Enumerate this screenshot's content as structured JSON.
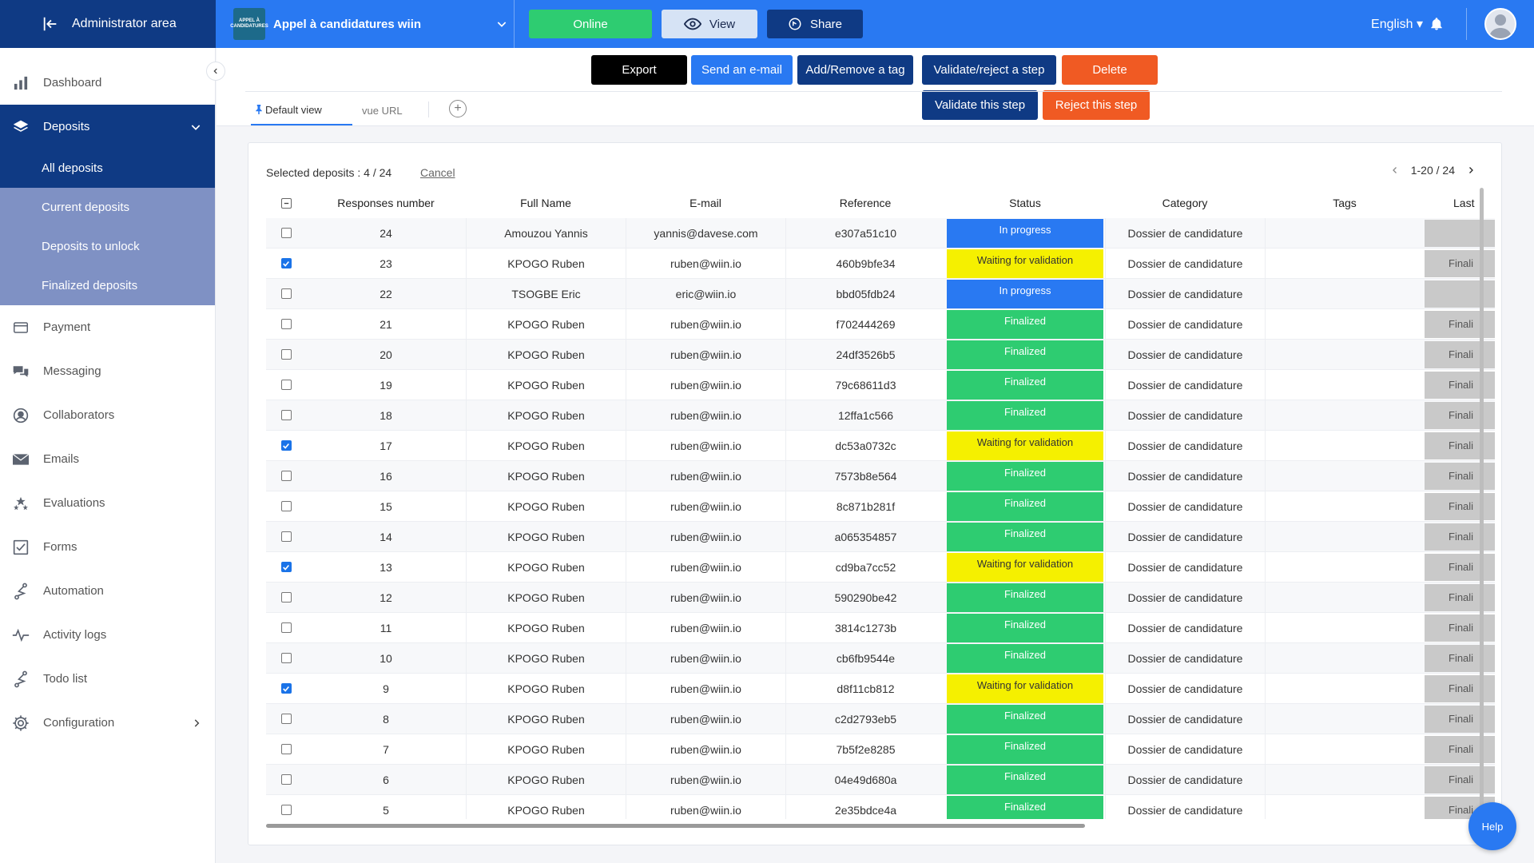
{
  "topbar": {
    "admin_label": "Administrator area",
    "project_name": "Appel à candidatures wiin",
    "project_logo_text": "APPEL À CANDIDATURES",
    "online_label": "Online",
    "view_label": "View",
    "share_label": "Share",
    "language": "English"
  },
  "sidebar": {
    "dashboard": "Dashboard",
    "deposits": "Deposits",
    "sub": {
      "all": "All deposits",
      "current": "Current deposits",
      "unlock": "Deposits to unlock",
      "finalized": "Finalized deposits"
    },
    "payment": "Payment",
    "messaging": "Messaging",
    "collaborators": "Collaborators",
    "emails": "Emails",
    "evaluations": "Evaluations",
    "forms": "Forms",
    "automation": "Automation",
    "activity_logs": "Activity logs",
    "todo": "Todo list",
    "configuration": "Configuration"
  },
  "actions": {
    "export": "Export",
    "send_email": "Send an e-mail",
    "tag": "Add/Remove a tag",
    "validate_reject": "Validate/reject a step",
    "delete": "Delete",
    "validate_step": "Validate this step",
    "reject_step": "Reject this step"
  },
  "tabs": {
    "default": "Default view",
    "url": "vue URL"
  },
  "table": {
    "selected_info": "Selected deposits : 4 / 24",
    "cancel": "Cancel",
    "pagination": "1-20 / 24",
    "headers": {
      "responses": "Responses number",
      "name": "Full Name",
      "email": "E-mail",
      "reference": "Reference",
      "status": "Status",
      "category": "Category",
      "tags": "Tags",
      "last": "Last"
    },
    "rows": [
      {
        "num": "24",
        "name": "Amouzou Yannis",
        "email": "yannis@davese.com",
        "ref": "e307a51c10",
        "status": "In progress",
        "category": "Dossier de candidature",
        "last": ""
      },
      {
        "num": "23",
        "name": "KPOGO Ruben",
        "email": "ruben@wiin.io",
        "ref": "460b9bfe34",
        "status": "Waiting for validation",
        "category": "Dossier de candidature",
        "last": "Finali"
      },
      {
        "num": "22",
        "name": "TSOGBE Eric",
        "email": "eric@wiin.io",
        "ref": "bbd05fdb24",
        "status": "In progress",
        "category": "Dossier de candidature",
        "last": ""
      },
      {
        "num": "21",
        "name": "KPOGO Ruben",
        "email": "ruben@wiin.io",
        "ref": "f702444269",
        "status": "Finalized",
        "category": "Dossier de candidature",
        "last": "Finali"
      },
      {
        "num": "20",
        "name": "KPOGO Ruben",
        "email": "ruben@wiin.io",
        "ref": "24df3526b5",
        "status": "Finalized",
        "category": "Dossier de candidature",
        "last": "Finali"
      },
      {
        "num": "19",
        "name": "KPOGO Ruben",
        "email": "ruben@wiin.io",
        "ref": "79c68611d3",
        "status": "Finalized",
        "category": "Dossier de candidature",
        "last": "Finali"
      },
      {
        "num": "18",
        "name": "KPOGO Ruben",
        "email": "ruben@wiin.io",
        "ref": "12ffa1c566",
        "status": "Finalized",
        "category": "Dossier de candidature",
        "last": "Finali"
      },
      {
        "num": "17",
        "name": "KPOGO Ruben",
        "email": "ruben@wiin.io",
        "ref": "dc53a0732c",
        "status": "Waiting for validation",
        "category": "Dossier de candidature",
        "last": "Finali"
      },
      {
        "num": "16",
        "name": "KPOGO Ruben",
        "email": "ruben@wiin.io",
        "ref": "7573b8e564",
        "status": "Finalized",
        "category": "Dossier de candidature",
        "last": "Finali"
      },
      {
        "num": "15",
        "name": "KPOGO Ruben",
        "email": "ruben@wiin.io",
        "ref": "8c871b281f",
        "status": "Finalized",
        "category": "Dossier de candidature",
        "last": "Finali"
      },
      {
        "num": "14",
        "name": "KPOGO Ruben",
        "email": "ruben@wiin.io",
        "ref": "a065354857",
        "status": "Finalized",
        "category": "Dossier de candidature",
        "last": "Finali"
      },
      {
        "num": "13",
        "name": "KPOGO Ruben",
        "email": "ruben@wiin.io",
        "ref": "cd9ba7cc52",
        "status": "Waiting for validation",
        "category": "Dossier de candidature",
        "last": "Finali"
      },
      {
        "num": "12",
        "name": "KPOGO Ruben",
        "email": "ruben@wiin.io",
        "ref": "590290be42",
        "status": "Finalized",
        "category": "Dossier de candidature",
        "last": "Finali"
      },
      {
        "num": "11",
        "name": "KPOGO Ruben",
        "email": "ruben@wiin.io",
        "ref": "3814c1273b",
        "status": "Finalized",
        "category": "Dossier de candidature",
        "last": "Finali"
      },
      {
        "num": "10",
        "name": "KPOGO Ruben",
        "email": "ruben@wiin.io",
        "ref": "cb6fb9544e",
        "status": "Finalized",
        "category": "Dossier de candidature",
        "last": "Finali"
      },
      {
        "num": "9",
        "name": "KPOGO Ruben",
        "email": "ruben@wiin.io",
        "ref": "d8f11cb812",
        "status": "Waiting for validation",
        "category": "Dossier de candidature",
        "last": "Finali"
      },
      {
        "num": "8",
        "name": "KPOGO Ruben",
        "email": "ruben@wiin.io",
        "ref": "c2d2793eb5",
        "status": "Finalized",
        "category": "Dossier de candidature",
        "last": "Finali"
      },
      {
        "num": "7",
        "name": "KPOGO Ruben",
        "email": "ruben@wiin.io",
        "ref": "7b5f2e8285",
        "status": "Finalized",
        "category": "Dossier de candidature",
        "last": "Finali"
      },
      {
        "num": "6",
        "name": "KPOGO Ruben",
        "email": "ruben@wiin.io",
        "ref": "04e49d680a",
        "status": "Finalized",
        "category": "Dossier de candidature",
        "last": "Finali"
      },
      {
        "num": "5",
        "name": "KPOGO Ruben",
        "email": "ruben@wiin.io",
        "ref": "2e35bdce4a",
        "status": "Finalized",
        "category": "Dossier de candidature",
        "last": "Finali"
      }
    ],
    "checked": [
      false,
      true,
      false,
      false,
      false,
      false,
      false,
      true,
      false,
      false,
      false,
      true,
      false,
      false,
      false,
      true,
      false,
      false,
      false,
      false
    ]
  },
  "colors": {
    "primary": "#2979f2",
    "navy": "#0f3a84",
    "status_in_progress": "#2979f2",
    "status_waiting": "#f5f000",
    "status_finalized": "#2ecc71",
    "delete": "#f05a23"
  },
  "help_label": "Help"
}
